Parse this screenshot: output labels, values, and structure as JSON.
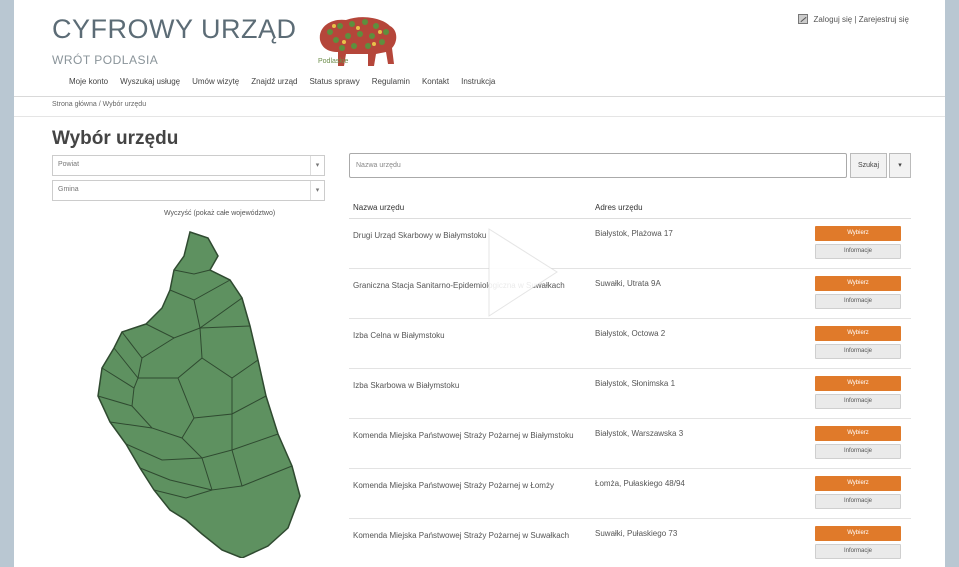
{
  "header": {
    "title": "CYFROWY URZĄD",
    "subtitle": "WRÓT PODLASIA",
    "logo_text": "Podlaskie",
    "auth": "Zaloguj się | Zarejestruj się"
  },
  "nav": [
    "Moje konto",
    "Wyszukaj usługę",
    "Umów wizytę",
    "Znajdź urząd",
    "Status sprawy",
    "Regulamin",
    "Kontakt",
    "Instrukcja"
  ],
  "breadcrumb": "Strona główna  /  Wybór urzędu",
  "page_title": "Wybór urzędu",
  "filters": {
    "powiat": "Powiat",
    "gmina": "Gmina",
    "clear": "Wyczyść (pokaż całe województwo)"
  },
  "search": {
    "placeholder": "Nazwa urzędu",
    "button": "Szukaj",
    "caret": "▾"
  },
  "table": {
    "col_name": "Nazwa urzędu",
    "col_addr": "Adres urzędu",
    "select_label": "Wybierz",
    "info_label": "Informacje",
    "rows": [
      {
        "name": "Drugi Urząd Skarbowy w Białymstoku",
        "addr": "Białystok, Plażowa 17"
      },
      {
        "name": "Graniczna Stacja Sanitarno-Epidemiologiczna w Suwałkach",
        "addr": "Suwałki, Utrata 9A"
      },
      {
        "name": "Izba Celna w Białymstoku",
        "addr": "Białystok, Octowa 2"
      },
      {
        "name": "Izba Skarbowa w Białymstoku",
        "addr": "Białystok, Słonimska 1"
      },
      {
        "name": "Komenda Miejska Państwowej Straży Pożarnej w Białymstoku",
        "addr": "Białystok, Warszawska 3"
      },
      {
        "name": "Komenda Miejska Państwowej Straży Pożarnej w Łomży",
        "addr": "Łomża, Pułaskiego 48/94"
      },
      {
        "name": "Komenda Miejska Państwowej Straży Pożarnej w Suwałkach",
        "addr": "Suwałki, Pułaskiego 73"
      }
    ]
  },
  "colors": {
    "accent": "#e07a2a",
    "map": "#5e9160"
  }
}
